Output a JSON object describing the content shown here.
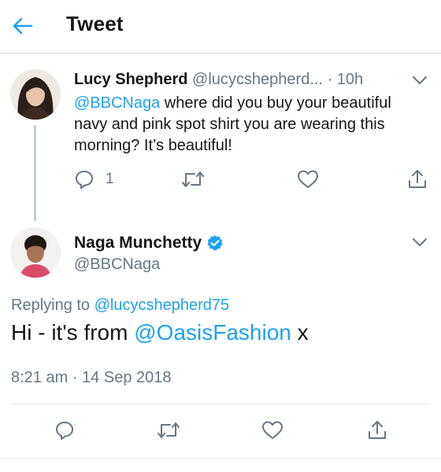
{
  "header": {
    "title": "Tweet",
    "back_icon": "back-arrow-icon"
  },
  "colors": {
    "accent": "#1da1f2",
    "muted": "#657786",
    "text": "#14171a",
    "verified": "#1da1f2"
  },
  "parent_tweet": {
    "display_name": "Lucy Shepherd",
    "handle": "@lucycshepherd...",
    "separator": "·",
    "time": "10h",
    "mention": "@BBCNaga",
    "text": " where did you buy your beautiful navy and pink spot shirt you are wearing this morning? It’s beautiful!",
    "reply_count": "1"
  },
  "main_tweet": {
    "display_name": "Naga Munchetty",
    "handle": "@BBCNaga",
    "verified": true,
    "replying_prefix": "Replying to ",
    "replying_to": "@lucycshepherd75",
    "text_before": "Hi - it's from ",
    "mention": "@OasisFashion",
    "text_after": " x",
    "time": "8:21 am",
    "separator": " · ",
    "date": "14 Sep 2018"
  }
}
